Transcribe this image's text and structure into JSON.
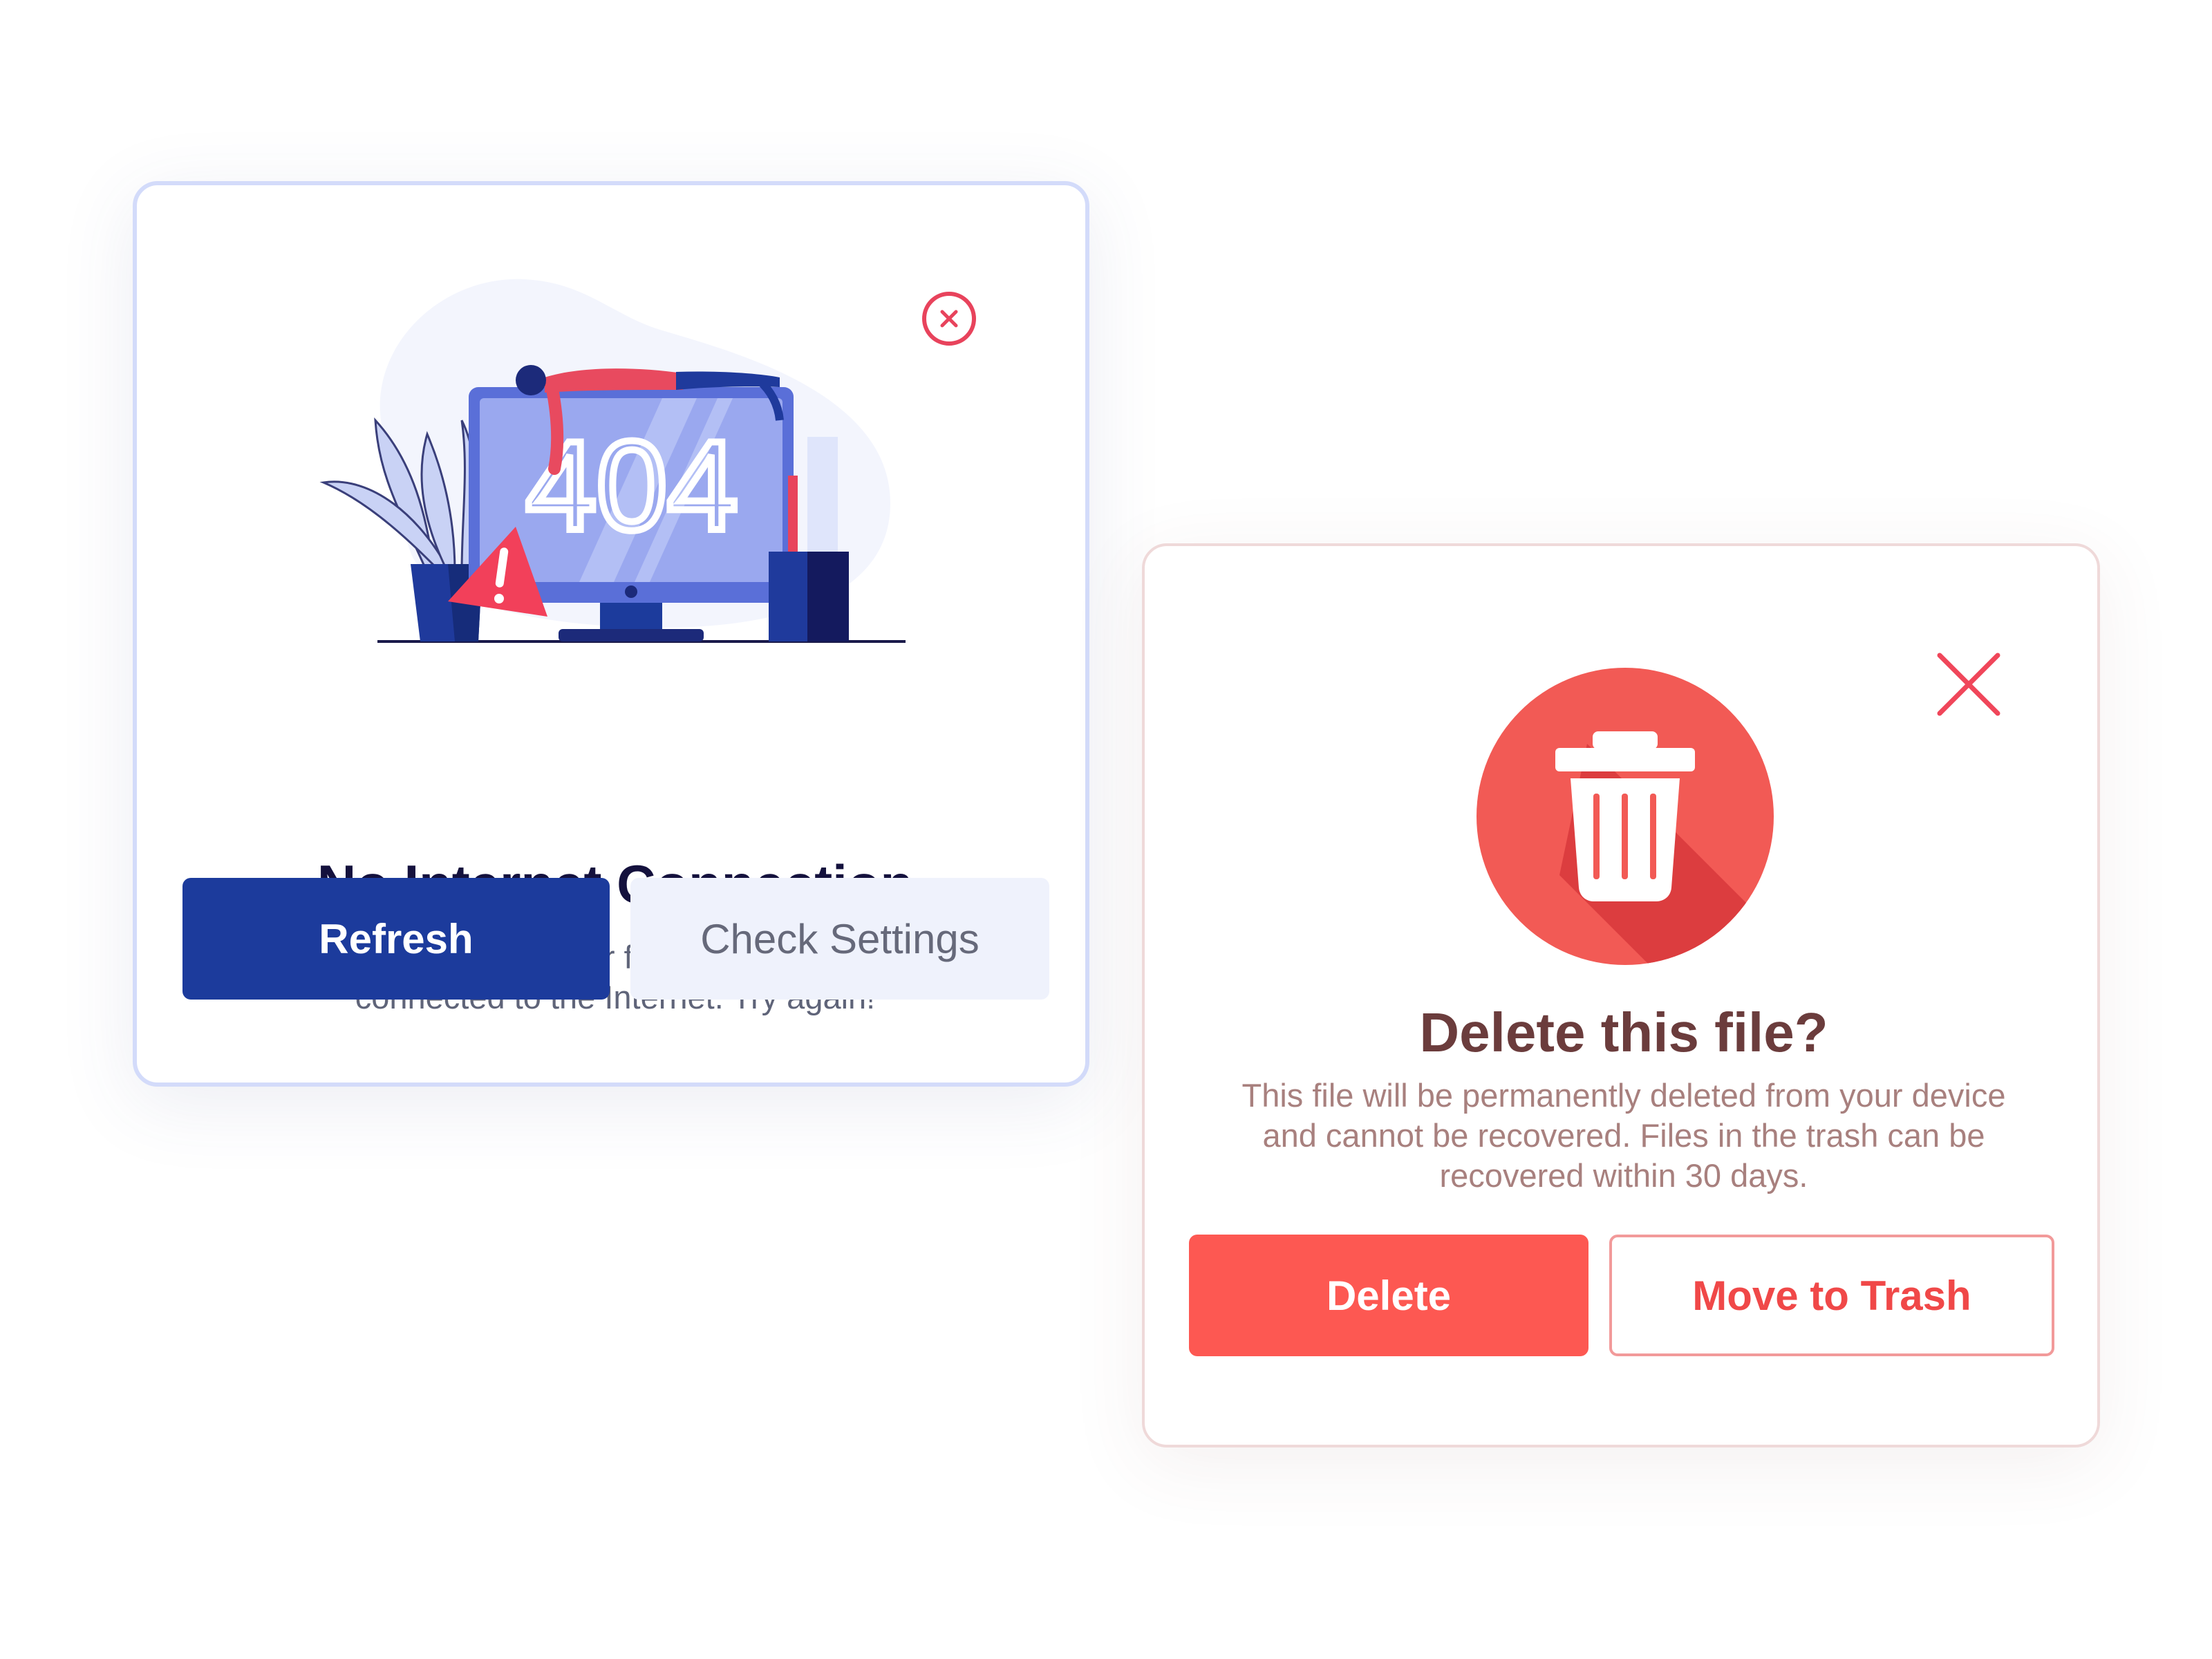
{
  "no_internet_dialog": {
    "illustration_text": "404",
    "title": "No Internet Connection",
    "description": "We failed to upload your files because you’re not connected to the Internet. Try again!",
    "refresh_label": "Refresh",
    "check_settings_label": "Check Settings",
    "close_icon": "close-circle-icon"
  },
  "delete_dialog": {
    "title": "Delete this file?",
    "description": "This file will be permanently deleted from your device and cannot be recovered. Files in the trash can be recovered within 30 days.",
    "delete_label": "Delete",
    "move_to_trash_label": "Move to Trash",
    "close_icon": "close-x-icon",
    "badge_icon": "trash-icon"
  },
  "colors": {
    "primary_blue": "#1c3b9c",
    "danger_red": "#fd5852",
    "close_pink": "#e8435c",
    "title_dark": "#14113d",
    "title_brown": "#6b3c3c"
  }
}
